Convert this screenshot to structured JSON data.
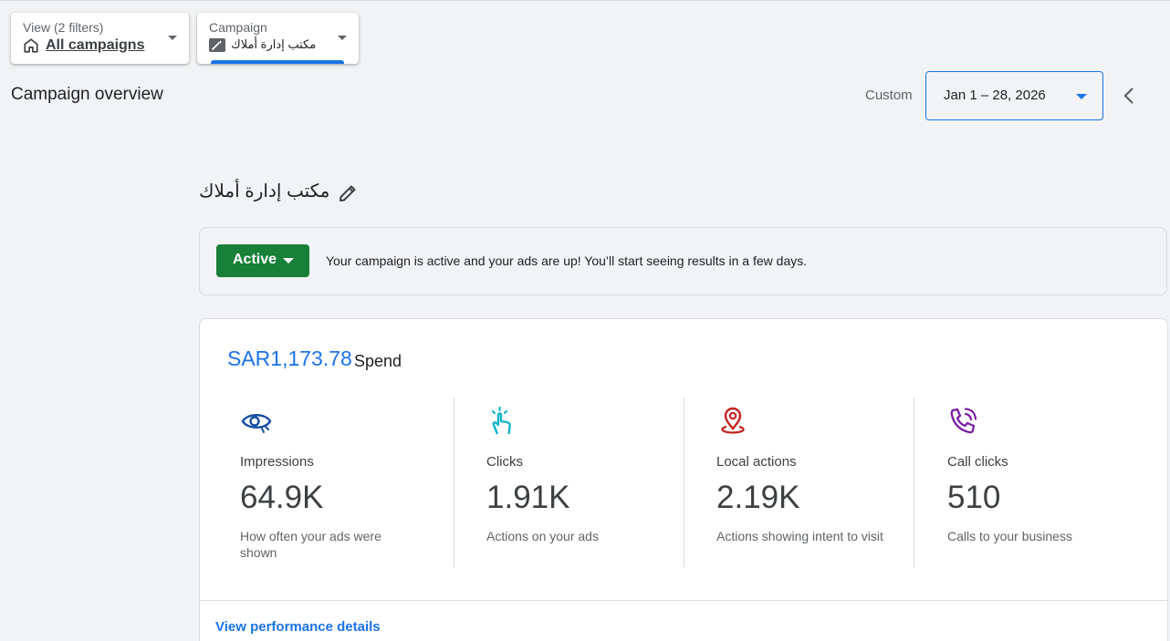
{
  "filters": {
    "view": {
      "label": "View (2 filters)",
      "value": "All campaigns",
      "icon": "home-icon"
    },
    "campaign": {
      "label": "Campaign",
      "value": "مكتب إدارة أملاك",
      "icon": "magic-wand-icon"
    }
  },
  "header": {
    "title": "Campaign overview",
    "date_range_label": "Custom",
    "date_range_value": "Jan 1 – 28, 2026"
  },
  "campaign": {
    "name": "مكتب إدارة أملاك",
    "status": "Active",
    "status_message": "Your campaign is active and your ads are up! You’ll start seeing results in a few days."
  },
  "summary": {
    "spend_value": "SAR1,173.78",
    "spend_label": "Spend",
    "metrics": [
      {
        "title": "Impressions",
        "value": "64.9K",
        "description": "How often your ads were shown",
        "icon": "eye-icon",
        "color": "#174ea6"
      },
      {
        "title": "Clicks",
        "value": "1.91K",
        "description": "Actions on your ads",
        "icon": "tap-icon",
        "color": "#12b5cb"
      },
      {
        "title": "Local actions",
        "value": "2.19K",
        "description": "Actions showing intent to visit",
        "icon": "location-pin-icon",
        "color": "#c5221f"
      },
      {
        "title": "Call clicks",
        "value": "510",
        "description": "Calls to your business",
        "icon": "phone-call-icon",
        "color": "#7b1fa2"
      }
    ],
    "details_link": "View performance details"
  },
  "colors": {
    "accent": "#1a73e8",
    "active": "#188038",
    "background": "#f1f3f4"
  }
}
